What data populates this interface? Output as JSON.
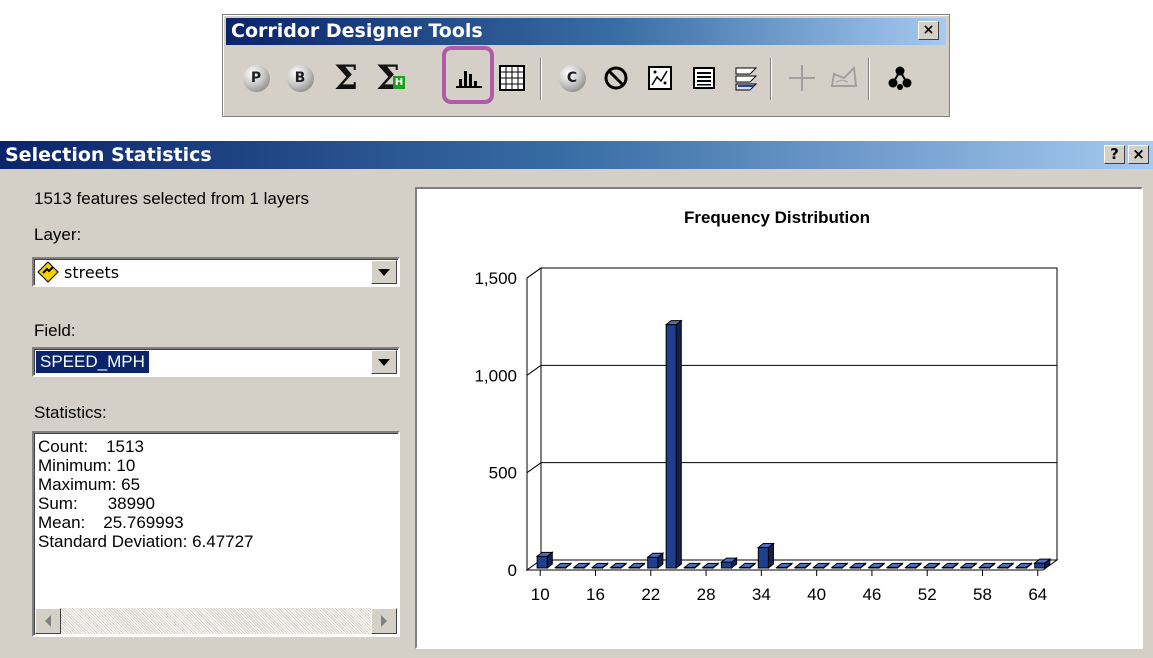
{
  "toolbar": {
    "title": "Corridor Designer Tools",
    "close_label": "×",
    "buttons": [
      {
        "name": "p-button",
        "label": "P",
        "icon": "circle-p-icon"
      },
      {
        "name": "b-button",
        "label": "B",
        "icon": "circle-b-icon"
      },
      {
        "name": "sum-button",
        "label": "Σ",
        "icon": "sigma-icon"
      },
      {
        "name": "sum-h-button",
        "label": "Σ",
        "sub": "H",
        "icon": "sigma-h-icon"
      },
      {
        "name": "histogram-button",
        "icon": "histogram-icon",
        "highlighted": true
      },
      {
        "name": "grid-button",
        "icon": "grid-icon"
      },
      {
        "name": "c-button",
        "label": "C",
        "icon": "circle-c-icon"
      },
      {
        "name": "clear-button",
        "icon": "no-symbol-icon"
      },
      {
        "name": "raster-button",
        "icon": "raster-icon"
      },
      {
        "name": "table-button",
        "icon": "table-icon"
      },
      {
        "name": "layers-button",
        "icon": "layers-icon"
      },
      {
        "name": "crosshair-button",
        "icon": "crosshair-icon"
      },
      {
        "name": "polygon-button",
        "icon": "polygon-icon"
      },
      {
        "name": "network-button",
        "icon": "network-icon"
      }
    ],
    "highlight_color": "#b05aa8"
  },
  "dialog": {
    "title": "Selection Statistics",
    "help_label": "?",
    "close_label": "×",
    "summary": "1513 features selected from 1 layers",
    "layer_label": "Layer:",
    "layer_value": "streets",
    "layer_icon": "line-layer-icon",
    "field_label": "Field:",
    "field_value": "SPEED_MPH",
    "statistics_label": "Statistics:",
    "statistics": [
      {
        "label": "Count:",
        "value": "1513"
      },
      {
        "label": "Minimum:",
        "value": "10"
      },
      {
        "label": "Maximum:",
        "value": "65"
      },
      {
        "label": "Sum:",
        "value": "38990"
      },
      {
        "label": "Mean:",
        "value": "25.769993"
      },
      {
        "label": "Standard Deviation:",
        "value": "6.47727"
      }
    ]
  },
  "chart_data": {
    "type": "bar",
    "title": "Frequency Distribution",
    "xlabel": "",
    "ylabel": "",
    "ylim": [
      0,
      1500
    ],
    "yticks": [
      "0",
      "500",
      "1,000",
      "1,500"
    ],
    "ytick_values": [
      0,
      500,
      1000,
      1500
    ],
    "xticks": [
      "10",
      "16",
      "22",
      "28",
      "34",
      "40",
      "46",
      "52",
      "58",
      "64"
    ],
    "categories": [
      "10",
      "12",
      "14",
      "16",
      "18",
      "20",
      "22",
      "24",
      "26",
      "28",
      "30",
      "32",
      "34",
      "36",
      "38",
      "40",
      "42",
      "44",
      "46",
      "48",
      "50",
      "52",
      "54",
      "56",
      "58",
      "60",
      "62",
      "64"
    ],
    "values": [
      60,
      3,
      3,
      3,
      3,
      3,
      55,
      1250,
      3,
      3,
      30,
      3,
      105,
      3,
      3,
      3,
      3,
      3,
      3,
      3,
      3,
      3,
      3,
      3,
      3,
      3,
      3,
      25
    ],
    "bar_color": "#1f3f8f",
    "grid": true,
    "legend": "none"
  }
}
